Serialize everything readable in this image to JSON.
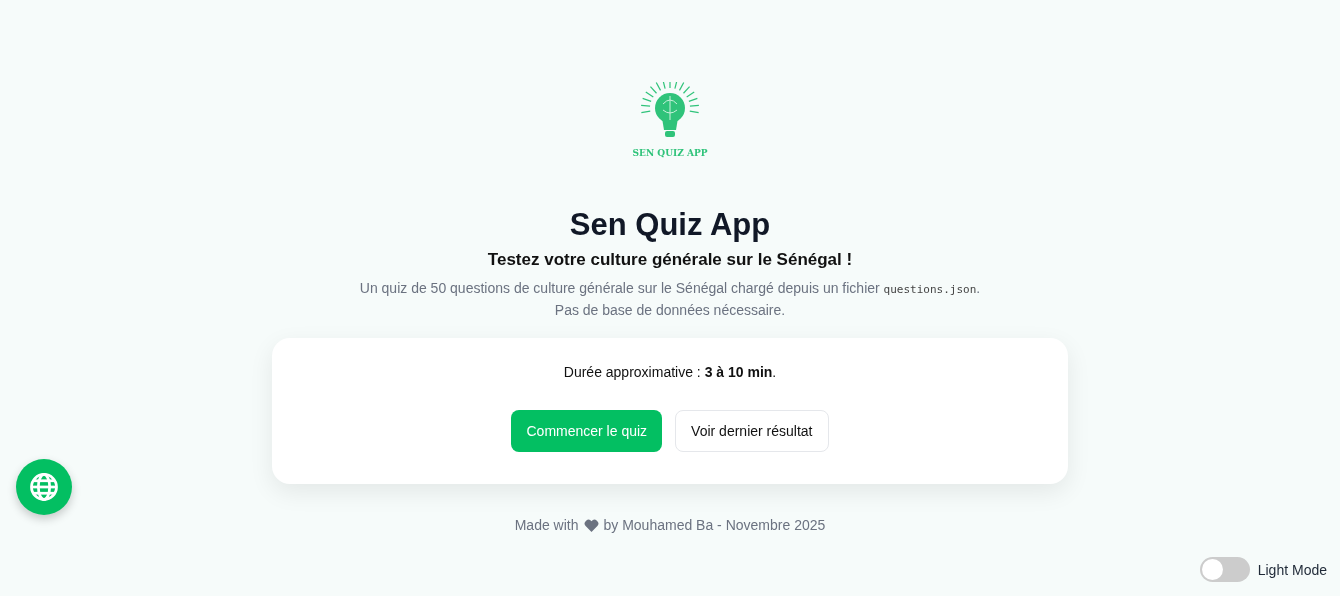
{
  "logo": {
    "text": "SEN QUIZ APP"
  },
  "title": "Sen Quiz App",
  "subtitle": "Testez votre culture générale sur le Sénégal !",
  "description": {
    "text": "Un quiz de 50 questions de culture générale sur le Sénégal chargé depuis un fichier",
    "code": "questions.json",
    "after": ".",
    "line2": "Pas de base de données nécessaire."
  },
  "card": {
    "duration": "Durée approximative : **3 à 10 min**.",
    "buttons": [
      {
        "label": "Commencer le quiz",
        "kind": "primary"
      },
      {
        "label": "Voir dernier résultat",
        "kind": "secondary"
      }
    ]
  },
  "footer": {
    "before": "Made with",
    "after": "by Mouhamed Ba - Novembre 2025"
  },
  "theme_toggle": {
    "label": "Light Mode",
    "on": false
  }
}
